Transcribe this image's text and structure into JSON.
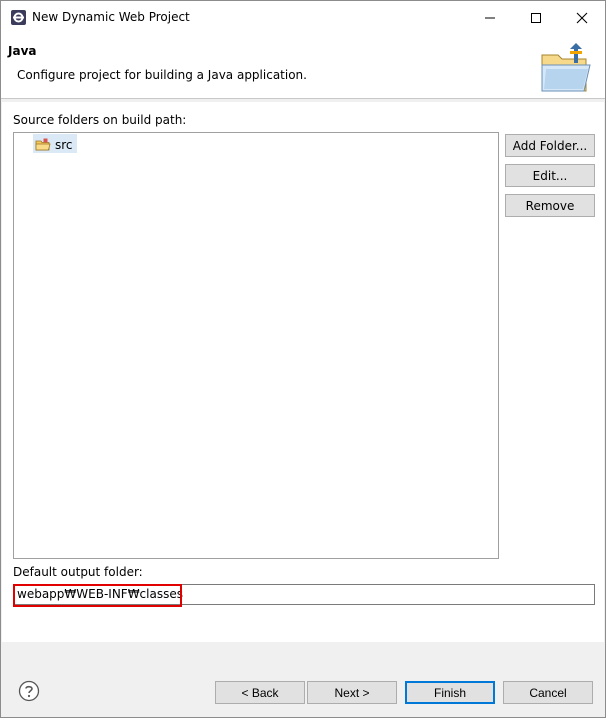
{
  "window": {
    "title": "New Dynamic Web Project",
    "controls": {
      "minimize_icon": "minimize-icon",
      "maximize_icon": "maximize-icon",
      "close_icon": "close-icon"
    }
  },
  "banner": {
    "title": "Java",
    "description": "Configure project for building a Java application.",
    "icon": "java-folder-wizard-icon"
  },
  "source": {
    "label": "Source folders on build path:",
    "items": [
      {
        "label": "src",
        "icon": "source-folder-icon",
        "selected": true
      }
    ],
    "buttons": {
      "add_folder": "Add Folder...",
      "edit": "Edit...",
      "remove": "Remove"
    }
  },
  "output": {
    "label": "Default output folder:",
    "value": "webapp₩WEB-INF₩classes"
  },
  "footer": {
    "help_icon": "help-icon",
    "back": "< Back",
    "next": "Next >",
    "finish": "Finish",
    "cancel": "Cancel"
  },
  "colors": {
    "highlight": "#e00000",
    "default_button_border": "#0078d7",
    "selection": "#dbe9f7"
  }
}
